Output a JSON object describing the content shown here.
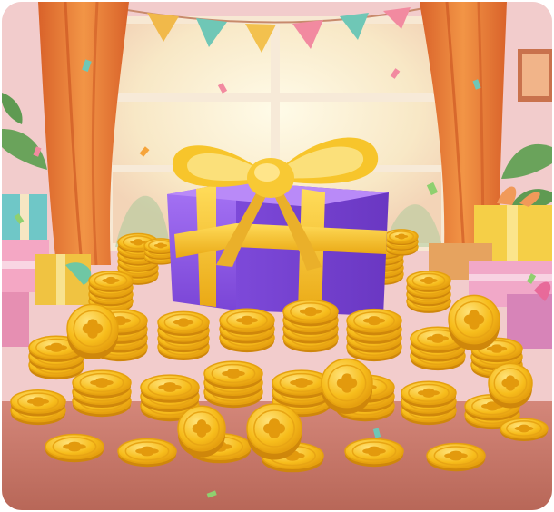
{
  "scene": {
    "icons": {
      "gift": "gift-box-icon",
      "coin": "clover-coin-icon",
      "bunting": "party-bunting-icon",
      "confetti": "confetti-icon"
    },
    "colors": {
      "wall": "#f3cfcf",
      "curtain": "#ef8a3c",
      "window_glow": "#fff6df",
      "box_purple": "#9a63f0",
      "ribbon_gold": "#f7c52b",
      "coin_gold": "#f5b817",
      "coin_dark": "#d58d0a",
      "floor": "#c97a68"
    }
  }
}
